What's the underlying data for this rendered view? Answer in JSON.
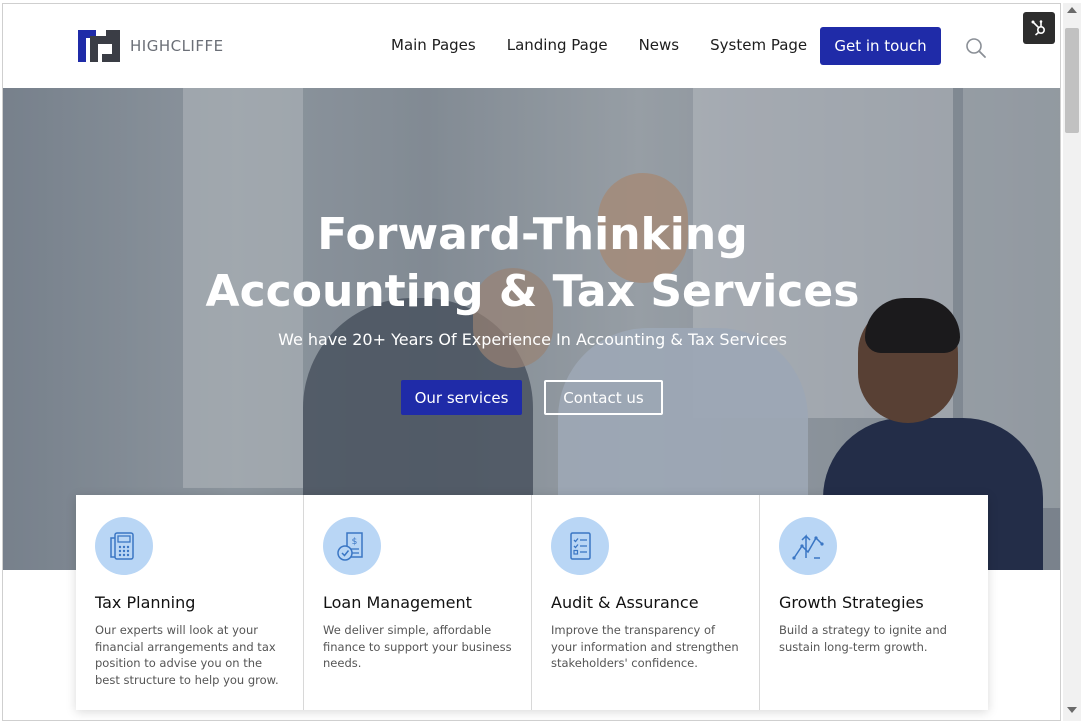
{
  "brand": {
    "name": "HIGHCLIFFE",
    "color": "#1f2ba8"
  },
  "nav": {
    "items": [
      {
        "label": "Main Pages"
      },
      {
        "label": "Landing Page"
      },
      {
        "label": "News"
      },
      {
        "label": "System Page"
      }
    ],
    "cta_label": "Get in touch",
    "search_icon": "search-icon",
    "hubspot_icon": "hubspot-icon"
  },
  "hero": {
    "title_line1": "Forward-Thinking",
    "title_line2": "Accounting & Tax Services",
    "subtitle": "We have 20+ Years Of Experience In Accounting & Tax Services",
    "primary_button": "Our services",
    "secondary_button": "Contact us"
  },
  "services": [
    {
      "icon": "calculator-phone-icon",
      "title": "Tax Planning",
      "text": "Our experts will look at your financial arrangements and tax position to advise you on the best structure to help you grow."
    },
    {
      "icon": "loan-document-icon",
      "title": "Loan Management",
      "text": "We deliver simple, affordable finance to support your business needs."
    },
    {
      "icon": "checklist-icon",
      "title": "Audit & Assurance",
      "text": "Improve the transparency of your information and strengthen stakeholders' confidence."
    },
    {
      "icon": "growth-chart-icon",
      "title": "Growth Strategies",
      "text": "Build a strategy to ignite and sustain long-term growth."
    }
  ],
  "colors": {
    "accent": "#1f2ba8",
    "icon_bg": "#b9d6f5",
    "icon_stroke": "#3a76c4"
  }
}
